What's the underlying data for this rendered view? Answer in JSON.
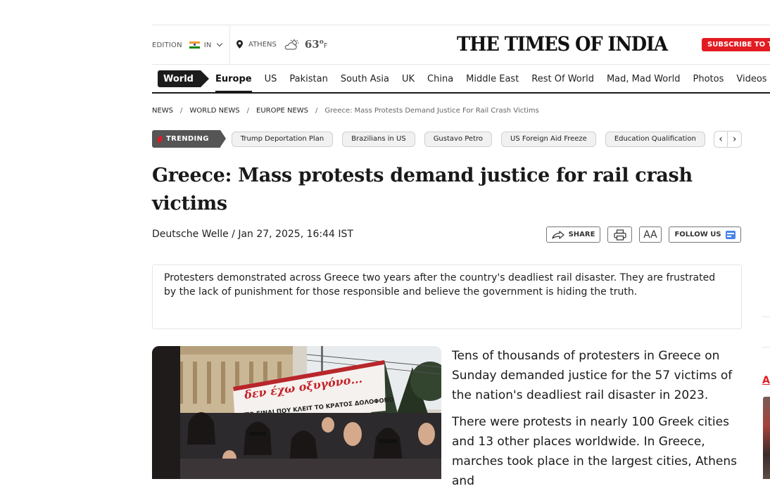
{
  "header": {
    "edition_label": "EDITION",
    "edition_code": "IN",
    "location": "ATHENS",
    "temperature": "63",
    "temperature_unit": "F",
    "logo_text": "THE TIMES OF INDIA",
    "subscribe_label": "SUBSCRIBE TO T",
    "flag_colors": [
      "#f39a33",
      "#ffffff",
      "#138808"
    ]
  },
  "nav": {
    "section": "World",
    "items": [
      {
        "label": "Europe",
        "active": true
      },
      {
        "label": "US"
      },
      {
        "label": "Pakistan"
      },
      {
        "label": "South Asia"
      },
      {
        "label": "UK"
      },
      {
        "label": "China"
      },
      {
        "label": "Middle East"
      },
      {
        "label": "Rest Of World"
      },
      {
        "label": "Mad, Mad World"
      },
      {
        "label": "Photos"
      },
      {
        "label": "Videos"
      }
    ]
  },
  "breadcrumb": [
    "NEWS",
    "WORLD NEWS",
    "EUROPE NEWS",
    "Greece: Mass Protests Demand Justice For Rail Crash Victims"
  ],
  "trending": {
    "label": "TRENDING",
    "items": [
      "Trump Deportation Plan",
      "Brazilians in US",
      "Gustavo Petro",
      "US Foreign Aid Freeze",
      "Education Qualification"
    ]
  },
  "article": {
    "headline": "Greece: Mass protests demand justice for rail crash victims",
    "byline": "Deutsche Welle / Jan 27, 2025, 16:44 IST",
    "share_label": "SHARE",
    "font_label": "AA",
    "follow_label": "FOLLOW US",
    "summary": "Protesters demonstrated across Greece two years after the country's deadliest rail disaster. They are frustrated by the lack of punishment for those responsible and believe the government is hiding the truth.",
    "paragraphs": [
      "Tens of thousands of protesters in Greece on Sunday demanded justice for the 57 victims of the nation's deadliest rail disaster in 2023.",
      "There were protests in nearly 100 Greek cities and 13 other places worldwide. In Greece, marches took place in the largest cities, Athens and"
    ],
    "banner_text": "δεν έχω οξυγόνο...",
    "banner_sub": "ΑΥΤΟ ΕΙΝΑΙ ΠΟΥ ΚΛΕΙΤ ΤΟ ΚΡΑΤΟΣ ΔΟΛΟΦΟΝΟ"
  },
  "rail": {
    "link_letter": "A"
  },
  "colors": {
    "accent_red": "#e21b22",
    "trending_gray": "#555555",
    "nav_dark": "#1c1c1c"
  }
}
